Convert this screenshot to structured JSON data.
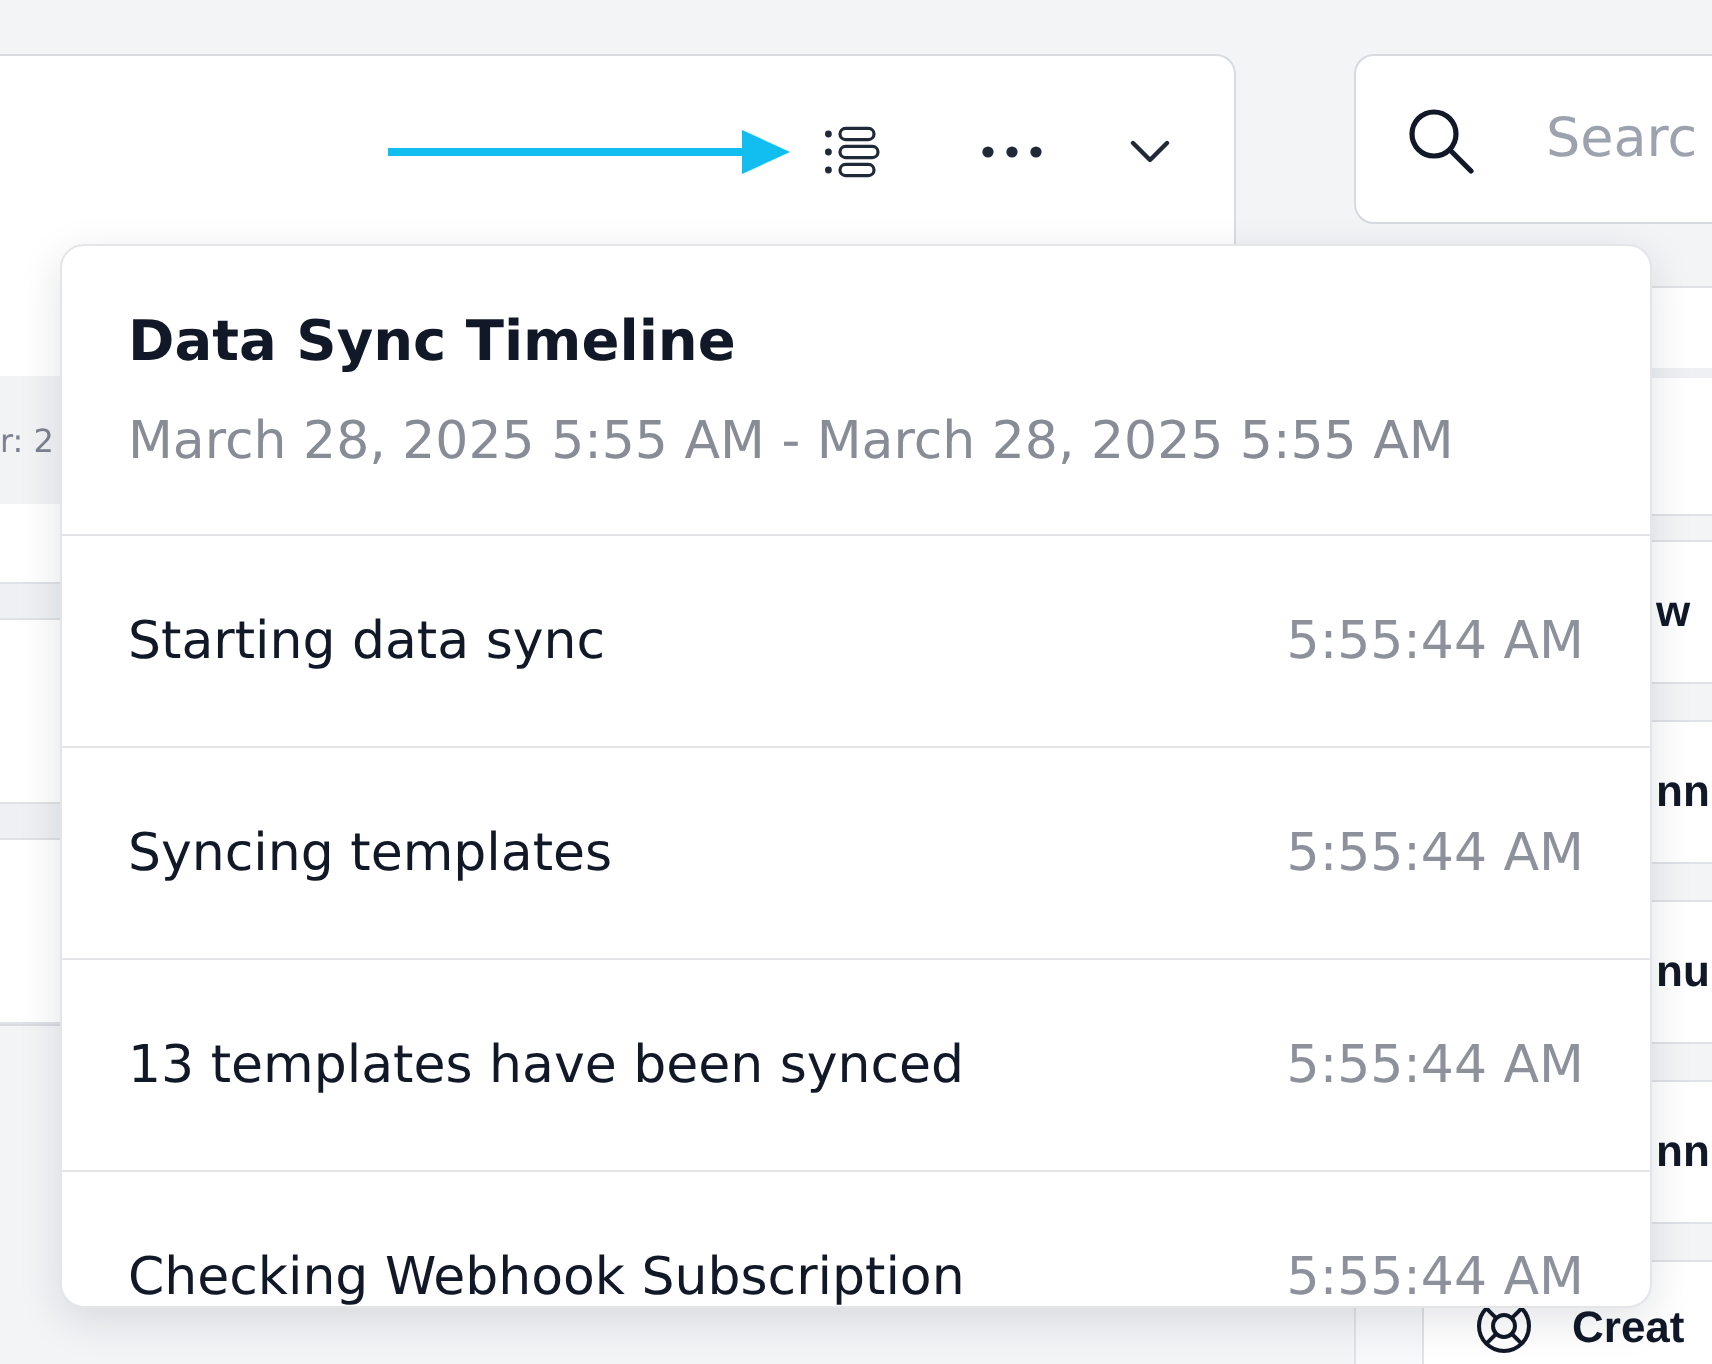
{
  "info_strip": {
    "text": "r: 2"
  },
  "search": {
    "placeholder": "Searc"
  },
  "side_cards": [
    {
      "text": "w"
    },
    {
      "text": "nn"
    },
    {
      "text": "nu"
    },
    {
      "text": "nn"
    }
  ],
  "create_button": {
    "label": "Creat"
  },
  "timeline_popover": {
    "title": "Data Sync Timeline",
    "range": "March 28, 2025 5:55 AM - March 28, 2025 5:55 AM",
    "events": [
      {
        "message": "Starting data sync",
        "time": "5:55:44 AM"
      },
      {
        "message": "Syncing templates",
        "time": "5:55:44 AM"
      },
      {
        "message": "13 templates have been synced",
        "time": "5:55:44 AM"
      },
      {
        "message": "Checking Webhook Subscription",
        "time": "5:55:44 AM"
      }
    ]
  }
}
